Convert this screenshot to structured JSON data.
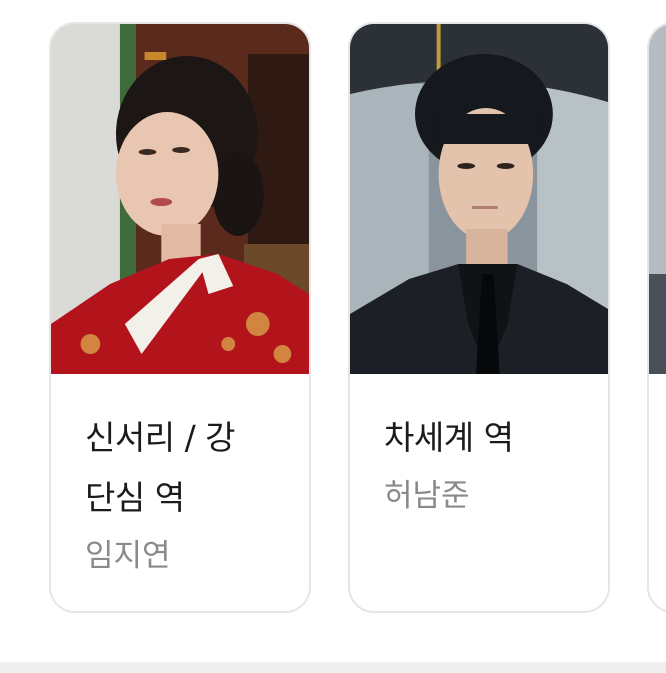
{
  "cast": [
    {
      "role": "신서리 / 강 단심 역",
      "actor": "임지연",
      "photo_icon": "portrait-photo-red-hanbok"
    },
    {
      "role": "차세계 역",
      "actor": "허남준",
      "photo_icon": "portrait-photo-black-suit-umbrella"
    }
  ],
  "colors": {
    "card_border": "#e6e6e6",
    "role_text": "#1b1b1b",
    "actor_text": "#8a8a8a"
  }
}
